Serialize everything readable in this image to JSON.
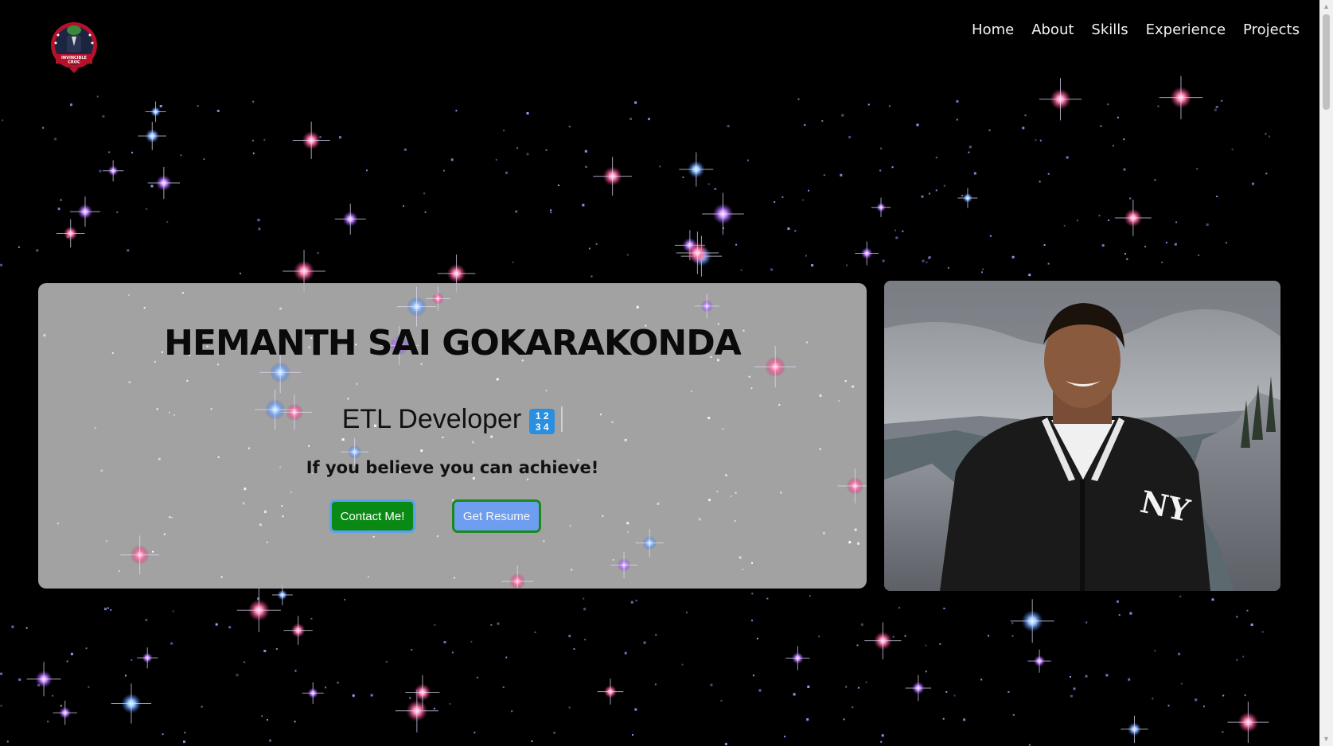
{
  "logo": {
    "icon": "crocodile-mascot-logo",
    "text": "INVINCIBLE CROC"
  },
  "nav": {
    "items": [
      "Home",
      "About",
      "Skills",
      "Experience",
      "Projects"
    ]
  },
  "hero": {
    "name": "HEMANTH SAI GOKARAKONDA",
    "role": "ETL Developer",
    "role_emoji_text": "1 2\n3 4",
    "tagline": "If you believe you can achieve!",
    "contact_label": "Contact Me!",
    "resume_label": "Get Resume"
  },
  "photo": {
    "icon": "profile-photo"
  },
  "colors": {
    "background": "#000000",
    "card": "#bebebe",
    "contact_button": "#0a8a14",
    "resume_button": "#6e9ef0",
    "nav_text": "#f2f2f2"
  }
}
